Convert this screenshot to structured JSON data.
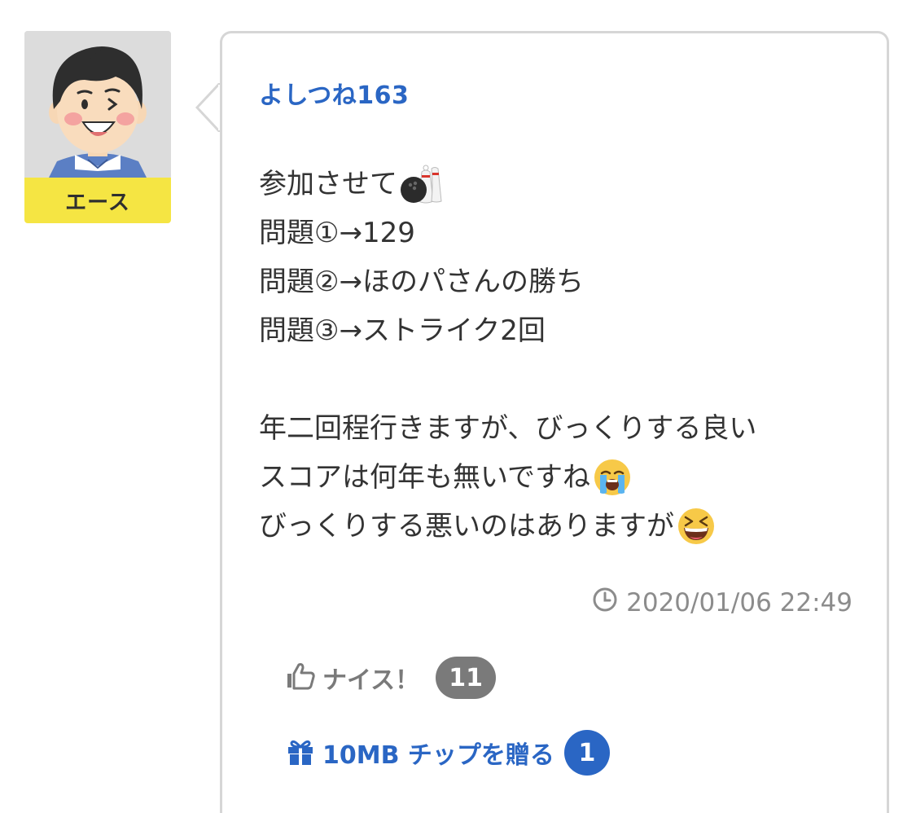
{
  "user": {
    "name": "よしつね163",
    "rank": "エース",
    "avatar_icon": "smiling-man-avatar-icon"
  },
  "comment": {
    "lines": [
      {
        "text": "参加させて",
        "emoji": "bowling-icon"
      },
      {
        "text": "問題①→129",
        "emoji": ""
      },
      {
        "text": "問題②→ほのパさんの勝ち",
        "emoji": ""
      },
      {
        "text": "問題③→ストライク2回",
        "emoji": ""
      },
      {
        "text": "",
        "emoji": ""
      },
      {
        "text": "年二回程行きますが、びっくりする良い",
        "emoji": ""
      },
      {
        "text": "スコアは何年も無いですね",
        "emoji": "loudly-crying-face-icon"
      },
      {
        "text": "びっくりする悪いのはありますが",
        "emoji": "grinning-squinting-face-icon"
      }
    ],
    "timestamp": "2020/01/06 22:49"
  },
  "actions": {
    "nice_label": "ナイス！",
    "nice_count": "11",
    "gift_label": "10MB チップを贈る",
    "gift_count": "1"
  },
  "colors": {
    "accent_blue": "#2a66c4",
    "rank_yellow": "#f5e543",
    "muted_gray": "#7a7a7a",
    "border_gray": "#d6d6d6"
  }
}
